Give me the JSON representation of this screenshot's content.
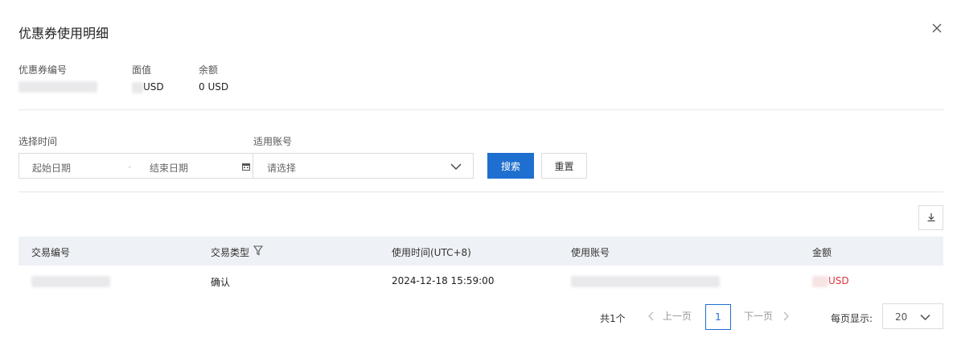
{
  "dialog": {
    "title": "优惠券使用明细"
  },
  "coupon": {
    "id_label": "优惠券编号",
    "face_label": "面值",
    "face_currency": "USD",
    "balance_label": "余额",
    "balance_value": "0 USD"
  },
  "filters": {
    "time_label": "选择时间",
    "start_placeholder": "起始日期",
    "end_placeholder": "结束日期",
    "account_label": "适用账号",
    "account_placeholder": "请选择",
    "search_label": "搜索",
    "reset_label": "重置"
  },
  "table": {
    "columns": [
      "交易编号",
      "交易类型",
      "使用时间(UTC+8)",
      "使用账号",
      "金额"
    ],
    "rows": [
      {
        "type": "确认",
        "time": "2024-12-18 15:59:00",
        "currency": "USD"
      }
    ]
  },
  "pagination": {
    "total": "共1个",
    "prev": "上一页",
    "current": "1",
    "next": "下一页",
    "page_size_label": "每页显示:",
    "page_size": "20"
  },
  "colors": {
    "primary": "#1f6fd0",
    "header_bg": "#eef1f5",
    "amount": "#d9363e"
  }
}
